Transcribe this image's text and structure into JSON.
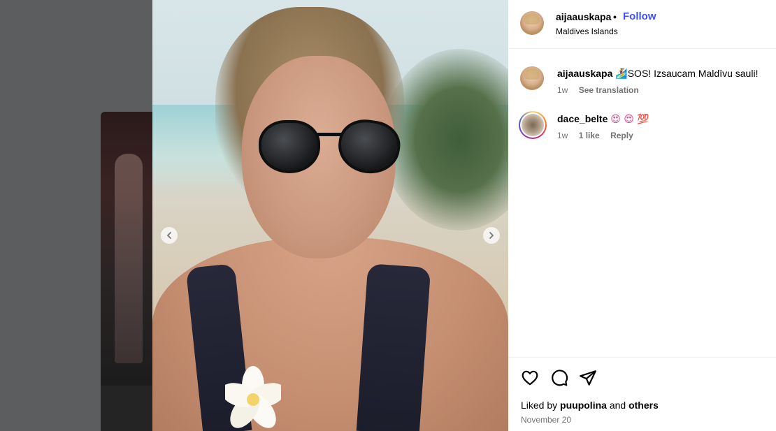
{
  "post": {
    "username": "aijaauskapa",
    "separator": "•",
    "follow_label": "Follow",
    "location": "Maldives Islands"
  },
  "comments": [
    {
      "username": "aijaauskapa",
      "emoji": "🏄‍♀️",
      "text": "SOS! Izsaucam Maldīvu sauli!",
      "time": "1w",
      "actions": [
        "See translation"
      ]
    },
    {
      "username": "dace_belte",
      "emojis": "😍 😍 💯",
      "time": "1w",
      "likes": "1 like",
      "actions": [
        "Reply"
      ]
    }
  ],
  "footer": {
    "liked_by_prefix": "Liked by",
    "liked_by_user": "puupolina",
    "liked_by_and": "and",
    "liked_by_others": "others",
    "date": "November 20"
  },
  "colors": {
    "follow": "#4150f7",
    "meta_text": "#737373",
    "divider": "#efefef",
    "backdrop": "#5b5d5f"
  },
  "icons": {
    "carousel_prev": "chevron-left-icon",
    "carousel_next": "chevron-right-icon",
    "like": "heart-icon",
    "comment": "comment-bubble-icon",
    "share": "paper-plane-icon"
  }
}
